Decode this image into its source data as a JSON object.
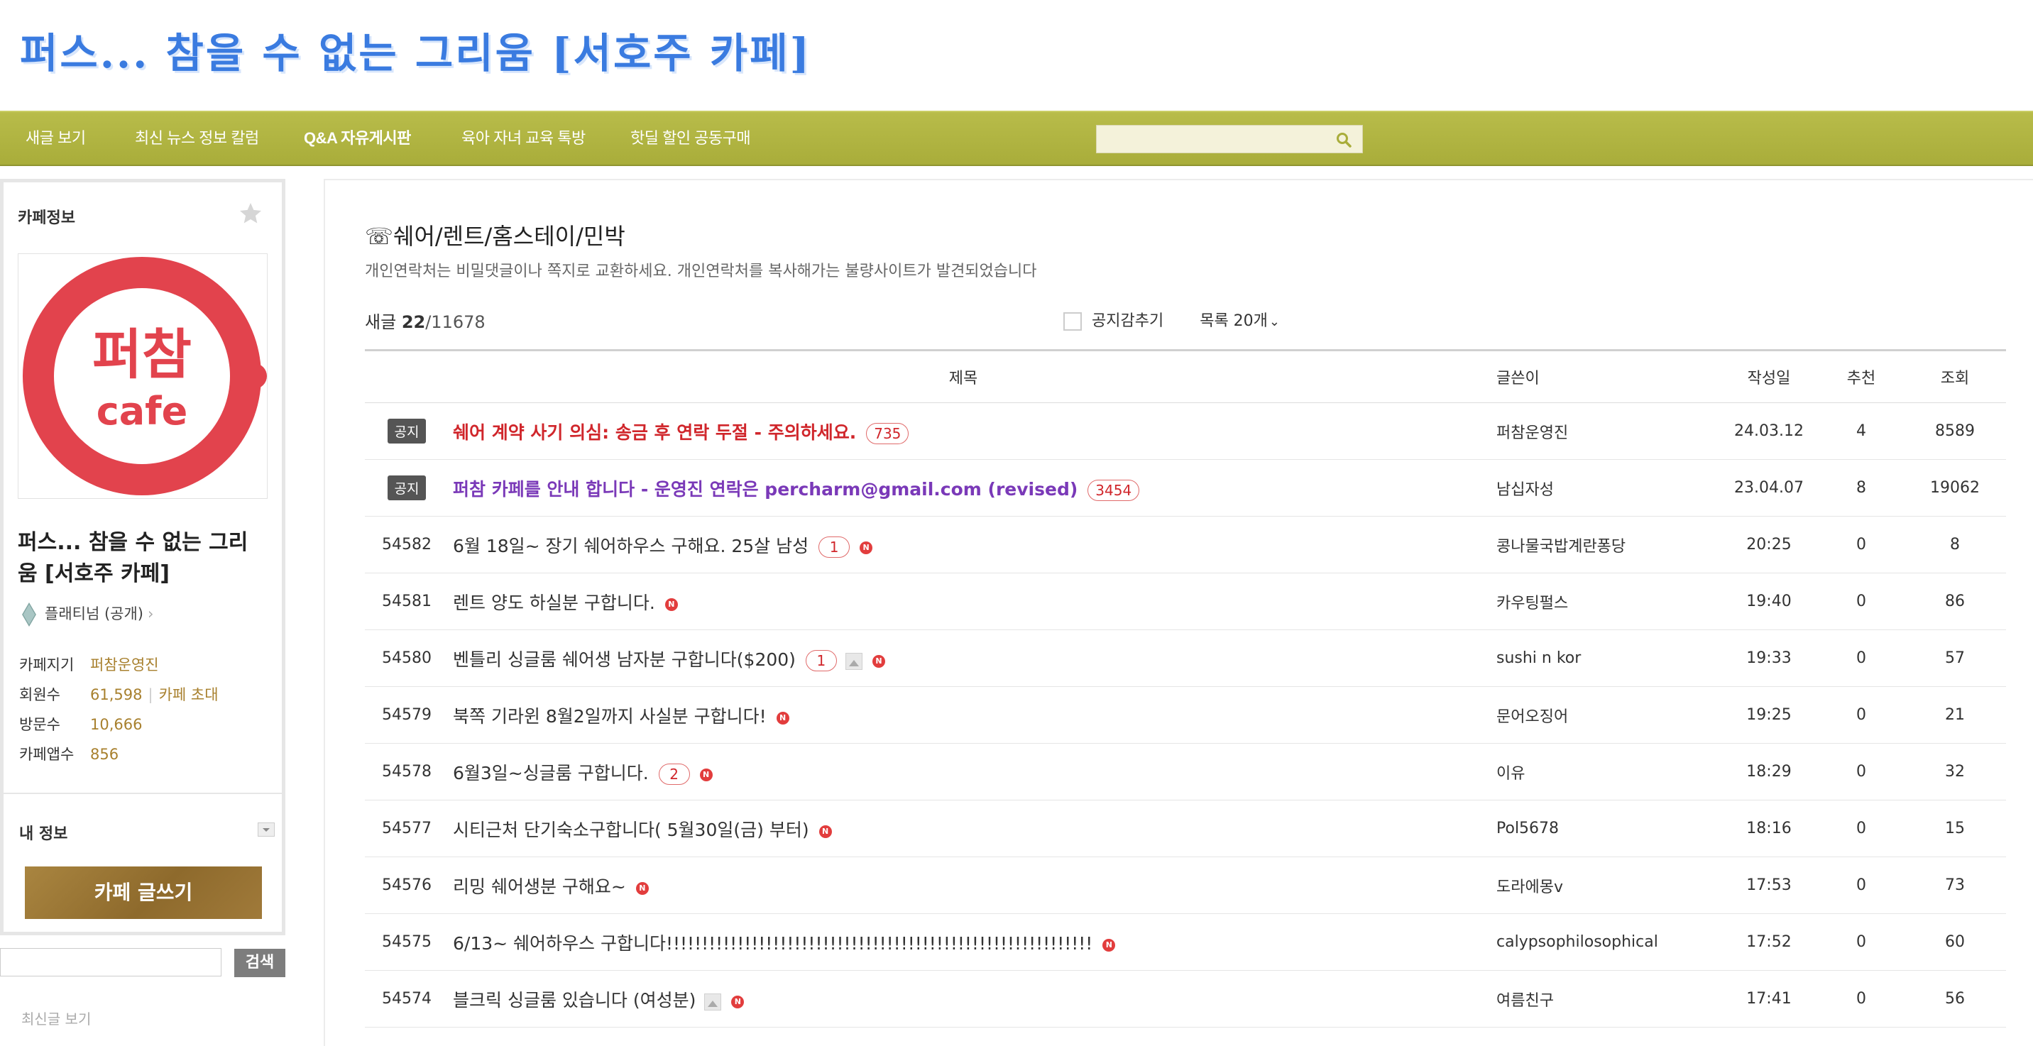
{
  "site": {
    "title": "퍼스... 참을 수 없는 그리움 [서호주 카페]"
  },
  "nav": {
    "items": [
      {
        "label": "새글 보기"
      },
      {
        "label": "최신 뉴스 정보 칼럼"
      },
      {
        "label": "Q&A 자유게시판"
      },
      {
        "label": "육아 자녀 교육 톡방"
      },
      {
        "label": "핫딜 할인 공동구매"
      }
    ],
    "search": {
      "placeholder": ""
    }
  },
  "sidebar": {
    "header": "카페정보",
    "logo": {
      "line1": "퍼참",
      "line2": "cafe"
    },
    "cafe_name": "퍼스... 참을 수 없는 그리움 [서호주 카페]",
    "grade": "플래티넘 (공개)",
    "manager_label": "카페지기",
    "manager_value": "퍼참운영진",
    "members_label": "회원수",
    "members_value": "61,598",
    "invite_label": "카페 초대",
    "visits_label": "방문수",
    "visits_value": "10,666",
    "app_label": "카페앱수",
    "app_value": "856",
    "my_info": "내 정보",
    "write_button": "카페 글쓰기",
    "search_button": "검색",
    "bottom_hint": "최신글 보기"
  },
  "board": {
    "title": "☏쉐어/렌트/홈스테이/민박",
    "description": "개인연락처는 비밀댓글이나 쪽지로 교환하세요. 개인연락처를 복사해가는 불량사이트가 발견되었습니다",
    "count_label": "새글",
    "count_new": "22",
    "count_total": "/11678",
    "hide_notice_label": "공지감추기",
    "page_size_label": "목록 20개",
    "columns": {
      "title": "제목",
      "author": "글쓴이",
      "date": "작성일",
      "recommend": "추천",
      "views": "조회"
    },
    "posts": [
      {
        "no": "공지",
        "notice": true,
        "style": "red",
        "title": "쉐어 계약 사기 의심: 송금 후 연락 두절 - 주의하세요.",
        "comments": "735",
        "image": false,
        "new": false,
        "author": "퍼참운영진",
        "date": "24.03.12",
        "recommend": "4",
        "views": "8589"
      },
      {
        "no": "공지",
        "notice": true,
        "style": "purple",
        "title": "퍼참 카페를 안내 합니다 - 운영진 연락은 percharm@gmail.com (revised)",
        "comments": "3454",
        "image": false,
        "new": false,
        "author": "남십자성",
        "date": "23.04.07",
        "recommend": "8",
        "views": "19062"
      },
      {
        "no": "54582",
        "notice": false,
        "style": "",
        "title": "6월 18일~ 장기 쉐어하우스 구해요. 25살 남성",
        "comments": "1",
        "image": false,
        "new": true,
        "author": "콩나물국밥계란퐁당",
        "date": "20:25",
        "recommend": "0",
        "views": "8"
      },
      {
        "no": "54581",
        "notice": false,
        "style": "",
        "title": "렌트 양도 하실분 구합니다.",
        "comments": "",
        "image": false,
        "new": true,
        "author": "카우팅펄스",
        "date": "19:40",
        "recommend": "0",
        "views": "86"
      },
      {
        "no": "54580",
        "notice": false,
        "style": "",
        "title": "벤틀리 싱글룸 쉐어생 남자분 구합니다($200)",
        "comments": "1",
        "image": true,
        "new": true,
        "author": "sushi n kor",
        "date": "19:33",
        "recommend": "0",
        "views": "57"
      },
      {
        "no": "54579",
        "notice": false,
        "style": "",
        "title": "북쪽 기라윈 8월2일까지 사실분 구합니다!",
        "comments": "",
        "image": false,
        "new": true,
        "author": "문어오징어",
        "date": "19:25",
        "recommend": "0",
        "views": "21"
      },
      {
        "no": "54578",
        "notice": false,
        "style": "",
        "title": "6월3일~싱글룸 구합니다.",
        "comments": "2",
        "image": false,
        "new": true,
        "author": "이유",
        "date": "18:29",
        "recommend": "0",
        "views": "32"
      },
      {
        "no": "54577",
        "notice": false,
        "style": "",
        "title": "시티근처 단기숙소구합니다( 5월30일(금) 부터)",
        "comments": "",
        "image": false,
        "new": true,
        "author": "Pol5678",
        "date": "18:16",
        "recommend": "0",
        "views": "15"
      },
      {
        "no": "54576",
        "notice": false,
        "style": "",
        "title": "리밍 쉐어생분 구해요~",
        "comments": "",
        "image": false,
        "new": true,
        "author": "도라에몽v",
        "date": "17:53",
        "recommend": "0",
        "views": "73"
      },
      {
        "no": "54575",
        "notice": false,
        "style": "",
        "title": "6/13~ 쉐어하우스 구합니다!!!!!!!!!!!!!!!!!!!!!!!!!!!!!!!!!!!!!!!!!!!!!!!!!!!!!!!!!!!!",
        "comments": "",
        "image": false,
        "new": true,
        "author": "calypsophilosophical",
        "date": "17:52",
        "recommend": "0",
        "views": "60"
      },
      {
        "no": "54574",
        "notice": false,
        "style": "",
        "title": "블크릭 싱글룸 있습니다 (여성분)",
        "comments": "",
        "image": true,
        "new": true,
        "author": "여름친구",
        "date": "17:41",
        "recommend": "0",
        "views": "56"
      }
    ]
  },
  "colors": {
    "nav_bg": "#a9ad3a",
    "accent_gold": "#a8802e",
    "logo_red": "#e2434d",
    "notice_red": "#d0262b",
    "notice_purple": "#7a39b8"
  }
}
